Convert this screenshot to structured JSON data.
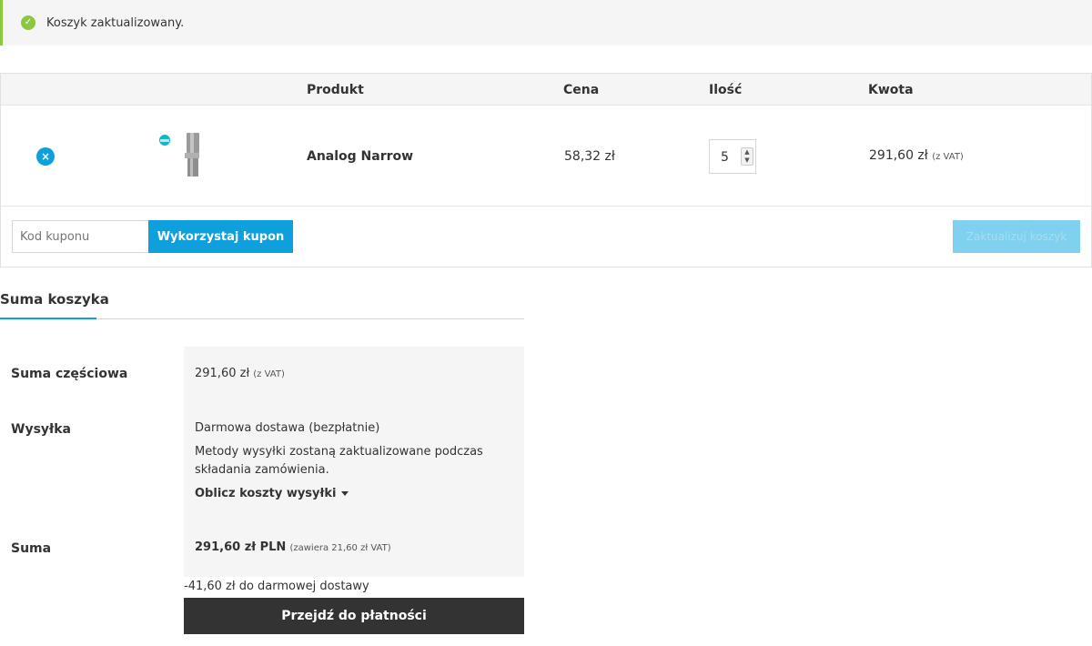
{
  "notice": {
    "text": "Koszyk zaktualizowany.",
    "icon": "check-circle-icon",
    "color": "#8dc63f"
  },
  "table": {
    "headers": {
      "product": "Produkt",
      "price": "Cena",
      "qty": "Ilość",
      "total": "Kwota"
    },
    "item": {
      "remove_icon": "×",
      "name": "Analog Narrow",
      "price": "58,32 zł",
      "quantity": "5",
      "total": "291,60 zł",
      "total_vat": "(z VAT)"
    }
  },
  "coupon": {
    "placeholder": "Kod kuponu",
    "apply_label": "Wykorzystaj kupon",
    "update_label": "Zaktualizuj koszyk"
  },
  "totals": {
    "title": "Suma koszyka",
    "subtotal_label": "Suma częściowa",
    "subtotal_value": "291,60 zł",
    "subtotal_vat": "(z VAT)",
    "shipping_label": "Wysyłka",
    "shipping_value": "Darmowa dostawa (bezpłatnie)",
    "shipping_note": "Metody wysyłki zostaną zaktualizowane podczas składania zamówienia.",
    "calc_link": "Oblicz koszty wysyłki",
    "total_label": "Suma",
    "total_value": "291,60 zł PLN",
    "total_vat": "(zawiera 21,60 zł VAT)",
    "free_shipping_note": "-41,60 zł do darmowej dostawy",
    "checkout_label": "Przejdź do płatności"
  },
  "colors": {
    "accent": "#0da0dc",
    "dark": "#333333",
    "panel": "#f5f5f5"
  }
}
